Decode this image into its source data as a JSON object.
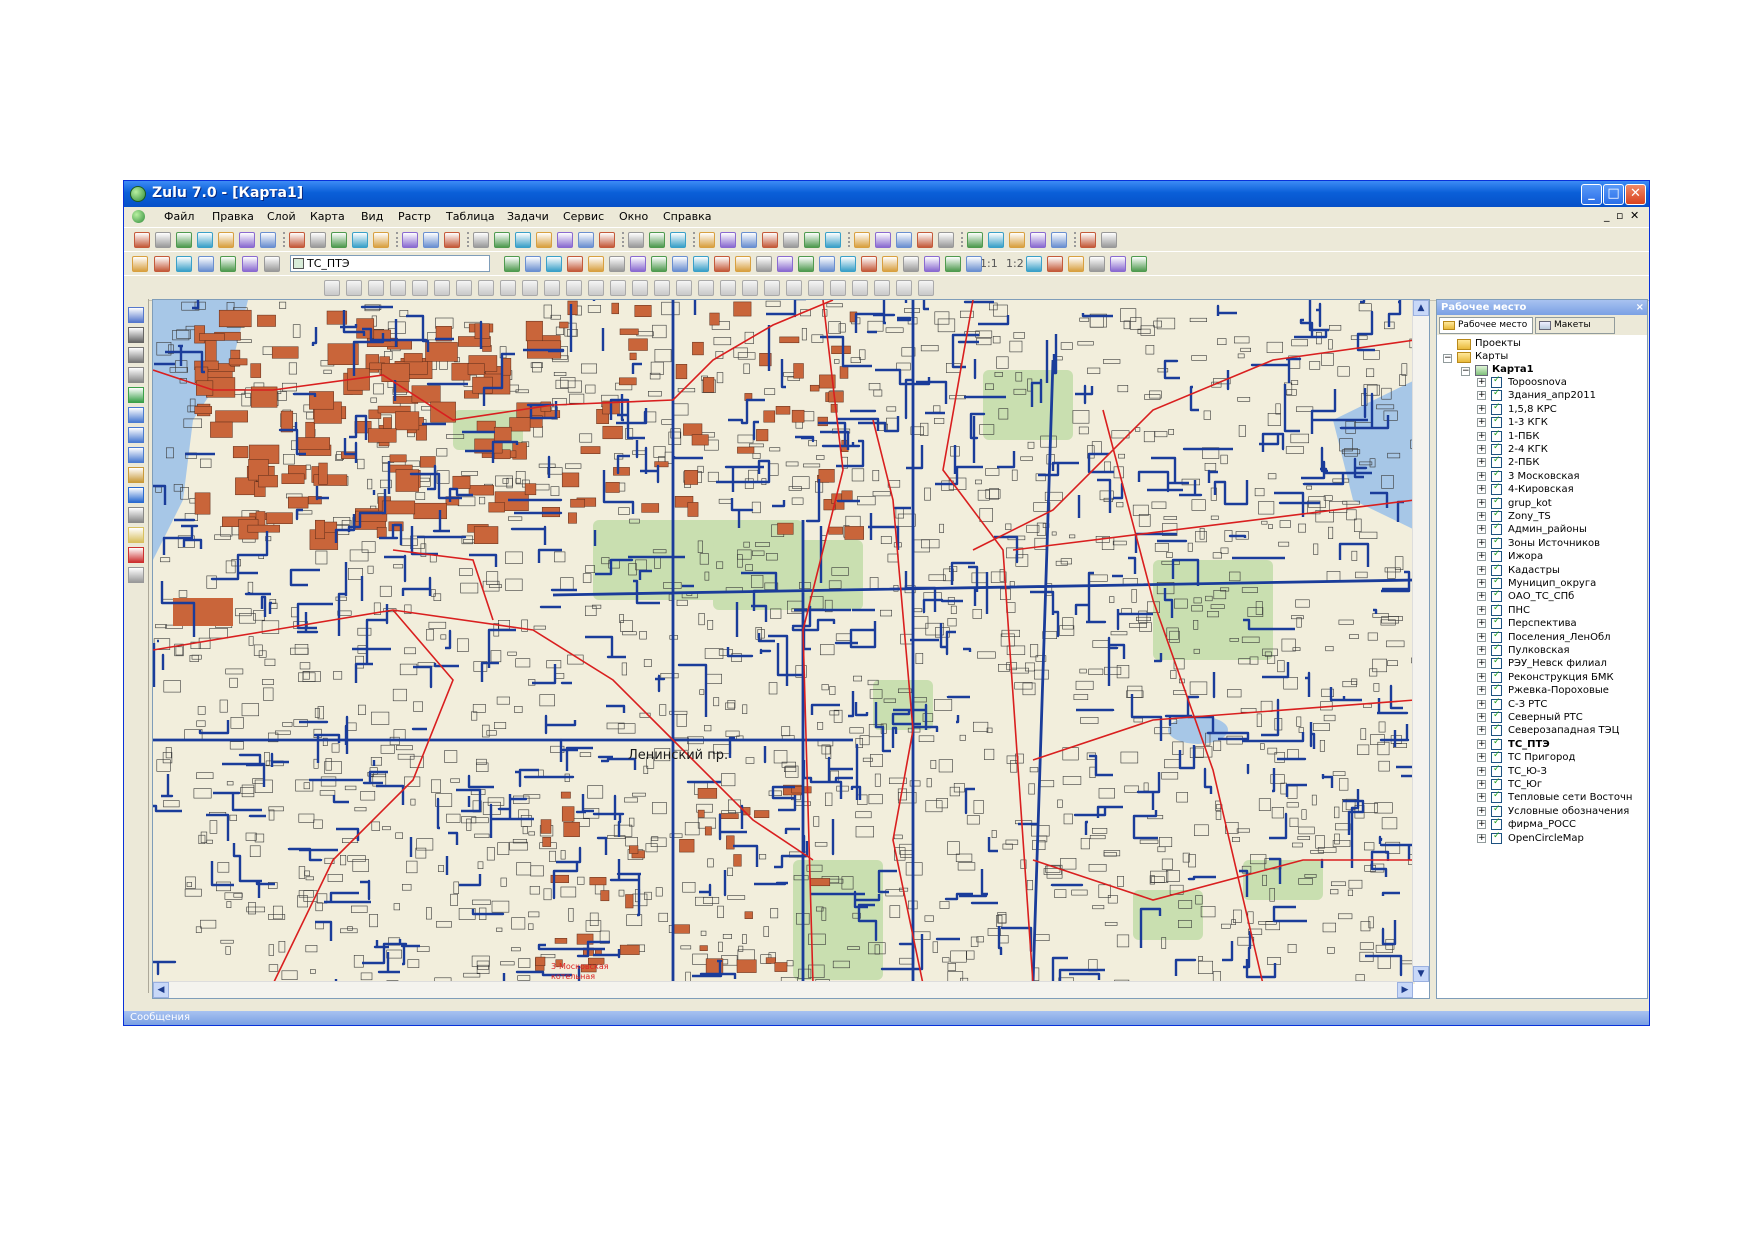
{
  "window": {
    "title": "Zulu 7.0 - [Карта1]",
    "controls": {
      "minimize": "_",
      "maximize": "□",
      "close": "✕"
    }
  },
  "menu": {
    "items": [
      "Файл",
      "Правка",
      "Слой",
      "Карта",
      "Вид",
      "Растр",
      "Таблица",
      "Задачи",
      "Сервис",
      "Окно",
      "Справка"
    ],
    "mdi_controls": [
      "_",
      "▫",
      "✕"
    ]
  },
  "toolbar2": {
    "layer_combo": "ТС_ПТЭ",
    "scale_labels": [
      "1:1",
      "1:2"
    ]
  },
  "map": {
    "labels": {
      "district": "Ленинский пр.",
      "station_line1": "3-Московская",
      "station_line2": "котельная"
    },
    "colors": {
      "background": "#f2eedc",
      "parks": "#c9dfb0",
      "water": "#a7c7e7",
      "buildings": "#c9653a",
      "pipes": "#1a3c9a",
      "borders": "#d91f1f"
    }
  },
  "workspace": {
    "title": "Рабочее место",
    "close": "×",
    "tabs": [
      "Рабочее место",
      "Макеты"
    ],
    "tree": {
      "projects": "Проекты",
      "maps": "Карты",
      "map1": "Карта1",
      "layers": [
        "Topoosnova",
        "Здания_апр2011",
        "1,5,8 КРС",
        "1-3 КГК",
        "1-ПБК",
        "2-4 КГК",
        "2-ПБК",
        "3 Московская",
        "4-Кировская",
        "grup_kot",
        "Zony_TS",
        "Админ_районы",
        "Зоны Источников",
        "Ижора",
        "Кадастры",
        "Муницип_округа",
        "ОАО_ТС_СПб",
        "ПНС",
        "Перспектива",
        "Поселения_ЛенОбл",
        "Пулковская",
        "РЭУ_Невск филиал",
        "Реконструкция БМК",
        "Ржевка-Пороховые",
        "С-З РТС",
        "Северный РТС",
        "Северозападная ТЭЦ",
        "ТС_ПТЭ",
        "ТС Пригород",
        "ТС_Ю-З",
        "ТС_Юг",
        "Тепловые сети Восточн",
        "Условные обозначения",
        "фирма_РОСС",
        "OpenCircleMap"
      ],
      "bold_layer": "ТС_ПТЭ"
    }
  },
  "statusbar": {
    "text": "Сообщения"
  }
}
